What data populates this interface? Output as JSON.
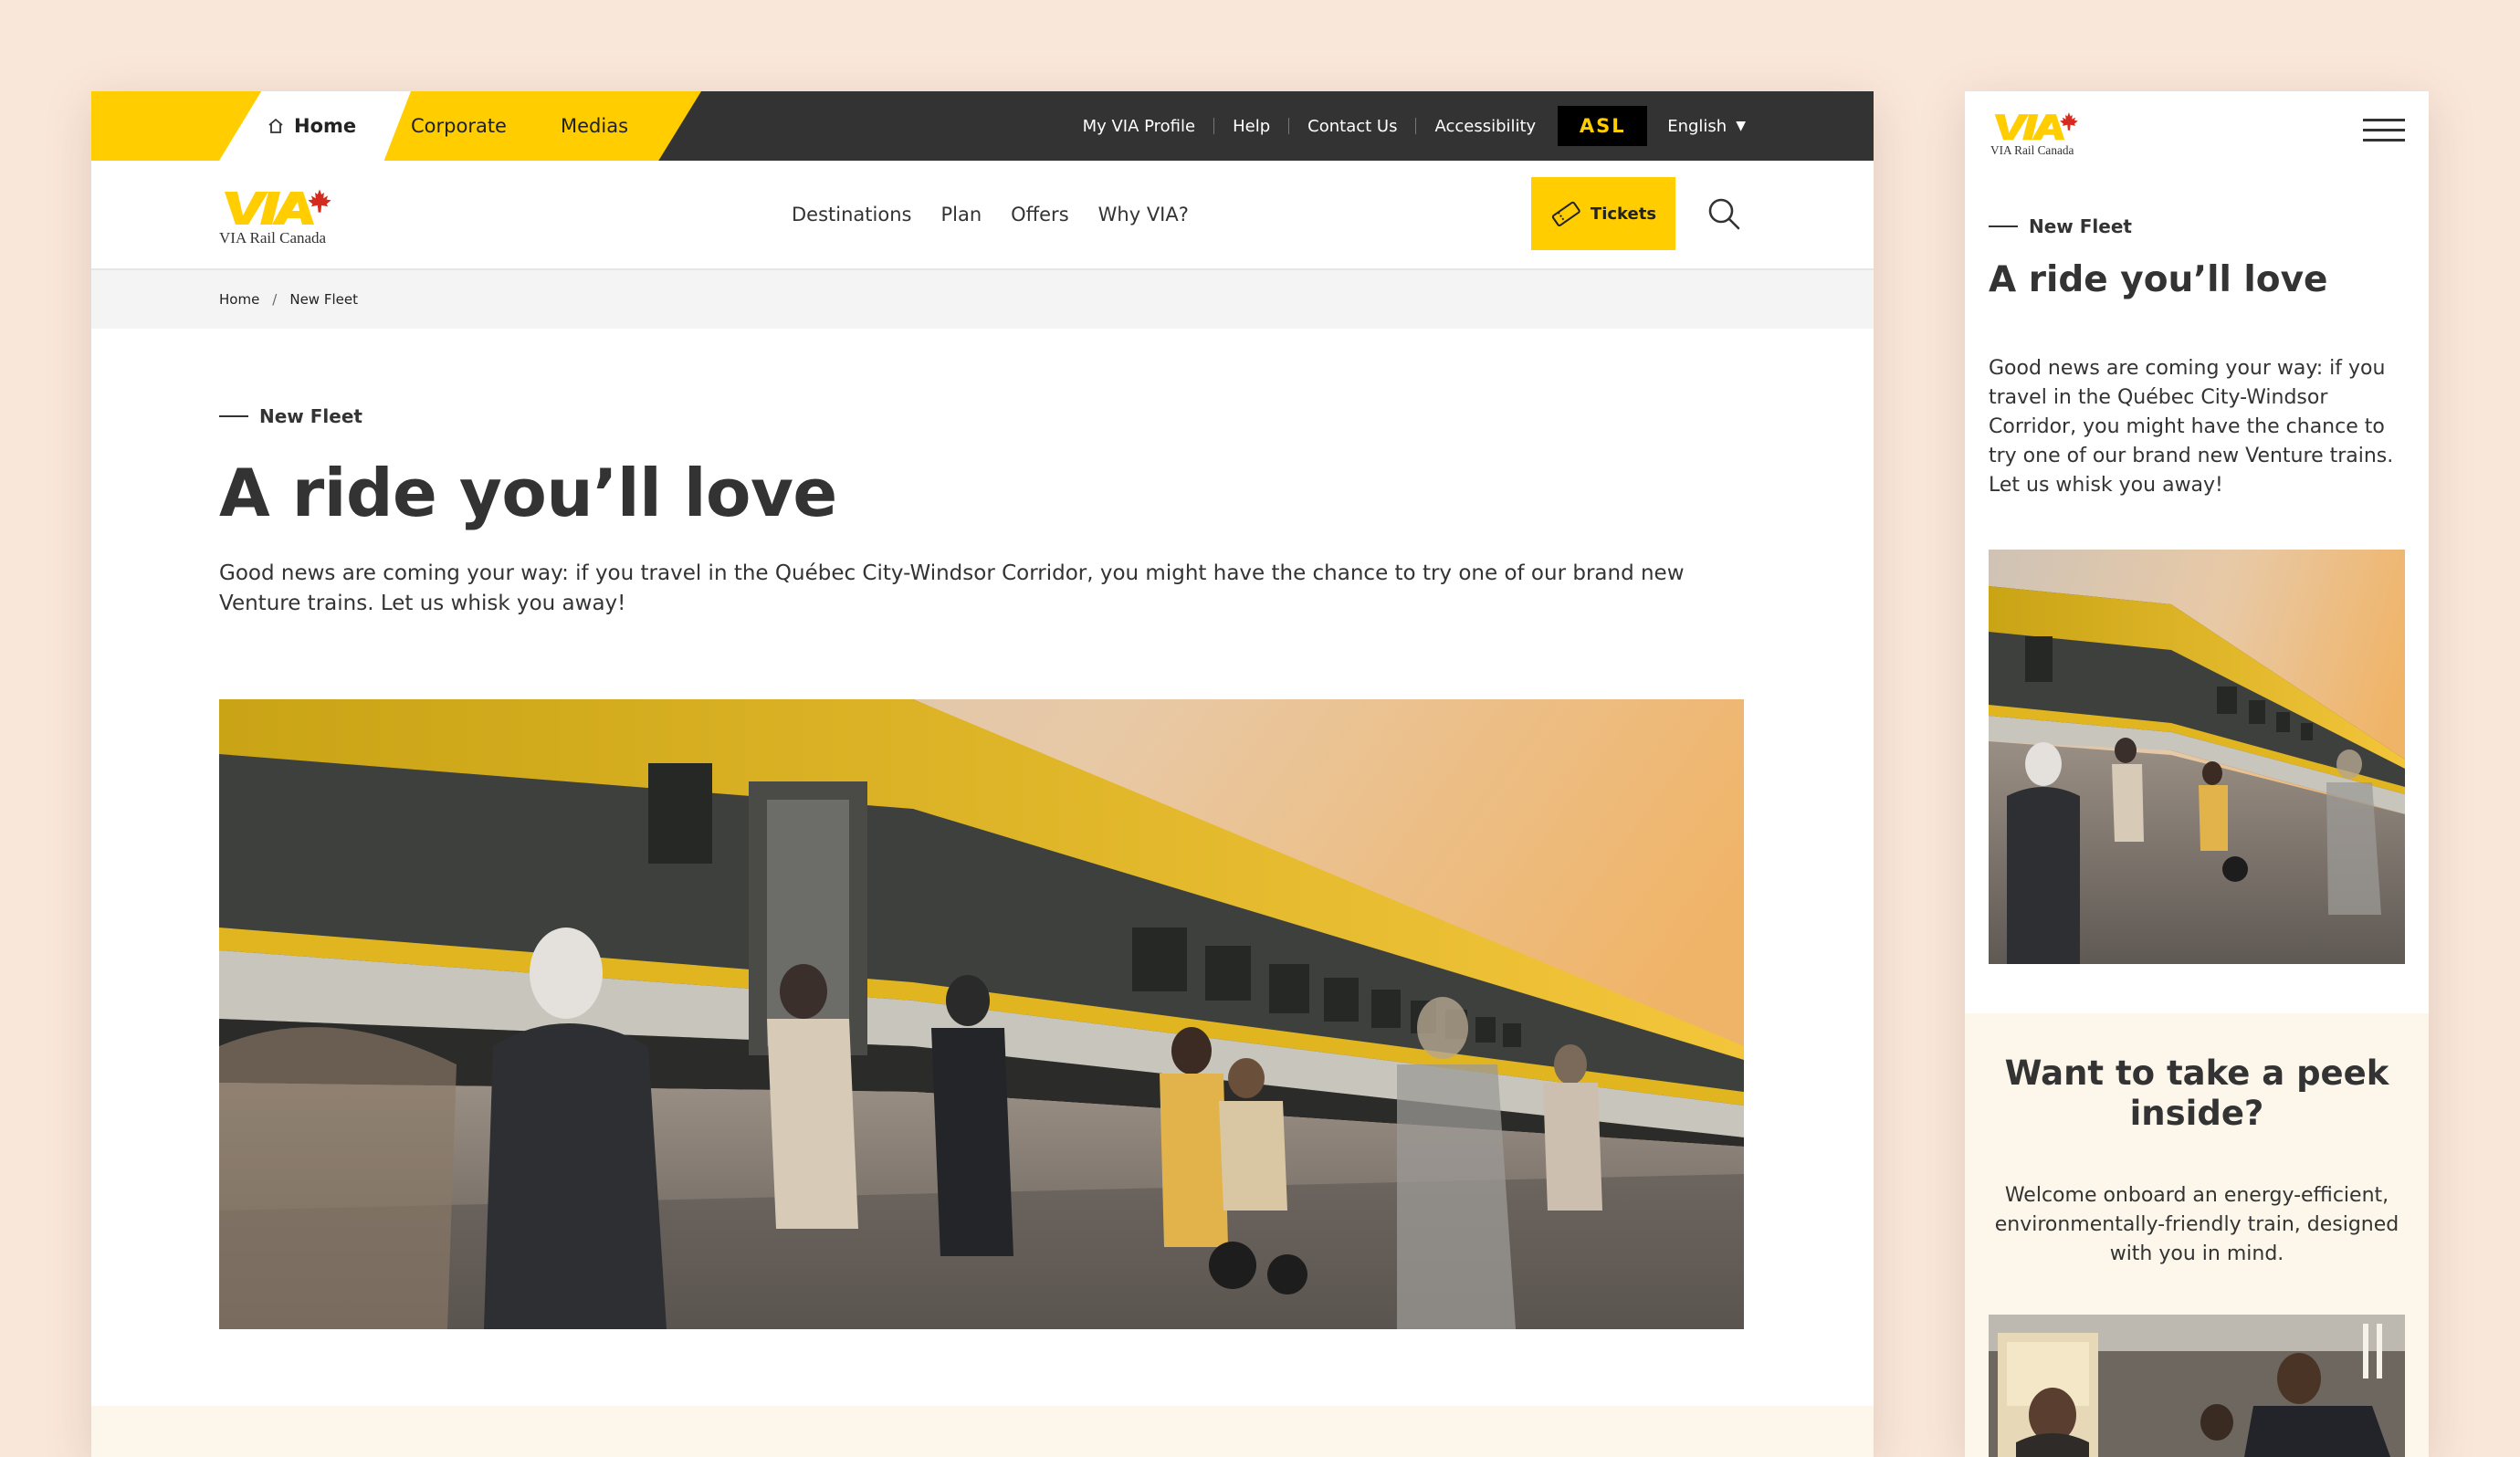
{
  "topbar": {
    "home_label": "Home",
    "corporate_label": "Corporate",
    "medias_label": "Medias",
    "utility_links": [
      "My VIA Profile",
      "Help",
      "Contact Us",
      "Accessibility"
    ],
    "asl_label": "ASL",
    "language": "English"
  },
  "brand": {
    "logo_mark": "VIA",
    "logo_text": "VIA Rail Canada",
    "primary_color": "#ffcd00",
    "dark_color": "#333333",
    "maple_leaf_color": "#d52b1e"
  },
  "mainnav": {
    "items": [
      "Destinations",
      "Plan",
      "Offers",
      "Why VIA?"
    ],
    "tickets_label": "Tickets"
  },
  "breadcrumb": {
    "home": "Home",
    "separator": "/",
    "current": "New Fleet"
  },
  "hero": {
    "eyebrow": "New Fleet",
    "title": "A ride you’ll love",
    "intro": "Good news are coming your way: if you travel in the Québec City-Windsor Corridor, you might have the chance to try one of our brand new Venture trains. Let us whisk you away!"
  },
  "peek": {
    "title": "Want to take a peek inside?",
    "text": "Welcome onboard an energy-efficient, environmentally-friendly train, designed with you in mind."
  },
  "icons": {
    "home": "home-icon",
    "caret": "caret-down-icon",
    "ticket": "ticket-icon",
    "search": "search-icon",
    "menu": "hamburger-menu-icon",
    "leaf": "maple-leaf-icon"
  },
  "page_background": "#f9e7da",
  "peek_background": "#fcf7ea"
}
